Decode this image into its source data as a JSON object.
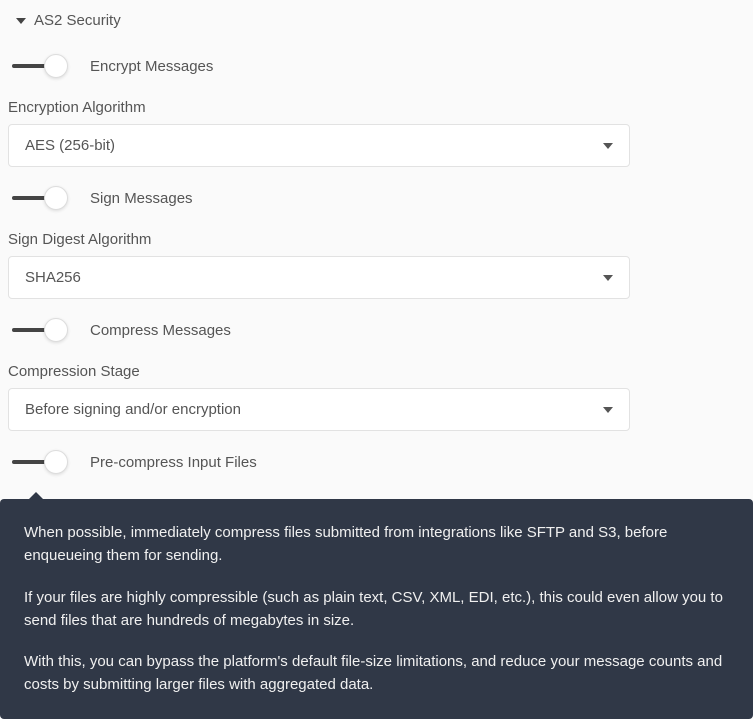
{
  "section": {
    "title": "AS2 Security"
  },
  "toggles": {
    "encrypt": "Encrypt Messages",
    "sign": "Sign Messages",
    "compress": "Compress Messages",
    "precompress": "Pre-compress Input Files"
  },
  "fields": {
    "encryption_algorithm": {
      "label": "Encryption Algorithm",
      "value": "AES (256-bit)"
    },
    "sign_digest_algorithm": {
      "label": "Sign Digest Algorithm",
      "value": "SHA256"
    },
    "compression_stage": {
      "label": "Compression Stage",
      "value": "Before signing and/or encryption"
    }
  },
  "tooltip": {
    "p1": "When possible, immediately compress files submitted from integrations like SFTP and S3, before enqueueing them for sending.",
    "p2": "If your files are highly compressible (such as plain text, CSV, XML, EDI, etc.), this could even allow you to send files that are hundreds of megabytes in size.",
    "p3": "With this, you can bypass the platform's default file-size limitations, and reduce your message counts and costs by submitting larger files with aggregated data."
  }
}
